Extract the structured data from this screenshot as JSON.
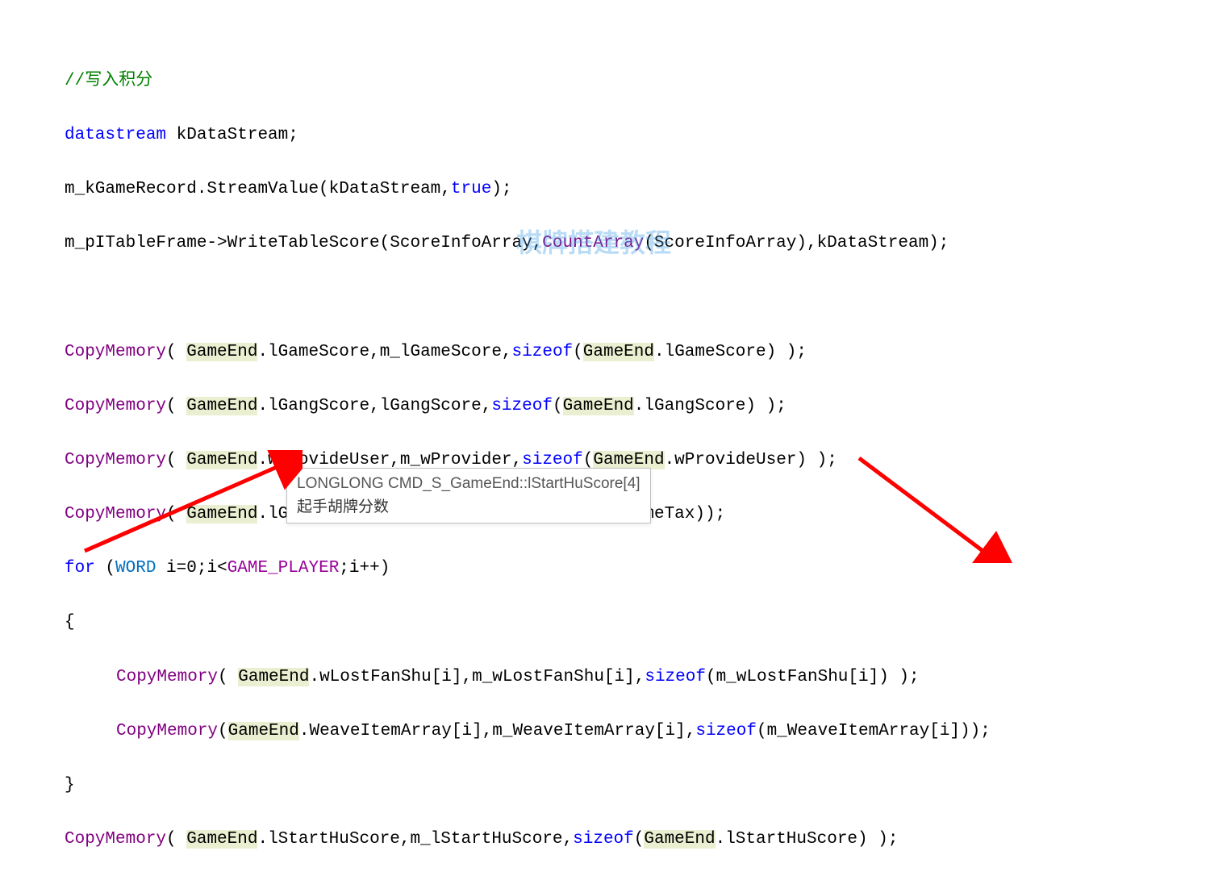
{
  "code": {
    "comment": "//写入积分",
    "line2_kw": "datastream",
    "line2_rest": " kDataStream;",
    "line3": "m_kGameRecord.StreamValue(kDataStream,",
    "line3_true": "true",
    "line3_end": ");",
    "line4_a": "m_pITableFrame->WriteTableScore(ScoreInfoArray,",
    "line4_fn": "CountArray",
    "line4_b": "(ScoreInfoArray),kDataStream);",
    "cm": "CopyMemory",
    "sizeof": "sizeof",
    "ge": "GameEnd",
    "l6_open": "( ",
    "l6_a": ".lGameScore,m_lGameScore,",
    "l6_b": "(",
    "l6_c": ".lGameScore) );",
    "l7_a": ".lGangScore,lGangScore,",
    "l7_c": ".lGangScore) );",
    "l8_a": ".wProvideUser,m_wProvider,",
    "l8_c": ".wProvideUser) );",
    "l9_a": ".lGameTax,lGameTaxs,",
    "l9_c": ".lGameTax));",
    "for_kw": "for",
    "for_a": " (",
    "word_kw": "WORD",
    "for_b": " i=0;i<",
    "gp": "GAME_PLAYER",
    "for_c": ";i++)",
    "brace_open": "{",
    "brace_close": "}",
    "l12_a": ".wLostFanShu[i],m_wLostFanShu[i],",
    "l12_c": "(m_wLostFanShu[i]) );",
    "l13_open": "(",
    "l13_a": ".WeaveItemArray[i],m_WeaveItemArray[i],",
    "l13_c": "(m_WeaveItemArray[i]));",
    "l15_a": ".lStartHuScore,m_lStartHuScore,",
    "l15_c": ".lStartHuScore) );"
  },
  "tooltip": {
    "line1": "LONGLONG CMD_S_GameEnd::lStartHuScore[4]",
    "line2": "起手胡牌分数"
  },
  "watermark": "棋牌搭建教程"
}
